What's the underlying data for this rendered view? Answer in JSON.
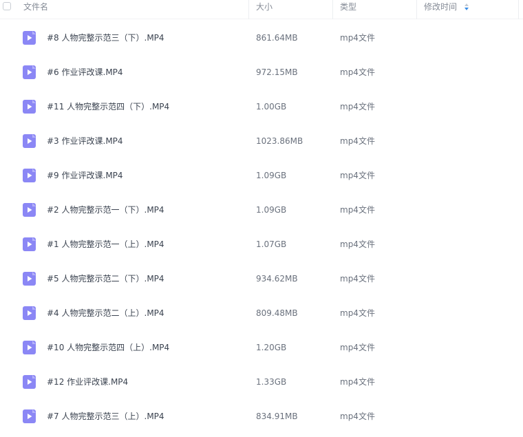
{
  "columns": {
    "name": "文件名",
    "size": "大小",
    "type": "类型",
    "modified": "修改时间"
  },
  "icons": {
    "file_icon": "video-file-icon",
    "sort_icon": "sort-icon",
    "accent_color": "#8b87f5"
  },
  "files": [
    {
      "name": "#8 人物完整示范三（下）.MP4",
      "size": "861.64MB",
      "type": "mp4文件",
      "modified": ""
    },
    {
      "name": "#6 作业评改课.MP4",
      "size": "972.15MB",
      "type": "mp4文件",
      "modified": ""
    },
    {
      "name": "#11 人物完整示范四（下）.MP4",
      "size": "1.00GB",
      "type": "mp4文件",
      "modified": ""
    },
    {
      "name": "#3 作业评改课.MP4",
      "size": "1023.86MB",
      "type": "mp4文件",
      "modified": ""
    },
    {
      "name": "#9 作业评改课.MP4",
      "size": "1.09GB",
      "type": "mp4文件",
      "modified": ""
    },
    {
      "name": "#2 人物完整示范一（下）.MP4",
      "size": "1.09GB",
      "type": "mp4文件",
      "modified": ""
    },
    {
      "name": "#1 人物完整示范一（上）.MP4",
      "size": "1.07GB",
      "type": "mp4文件",
      "modified": ""
    },
    {
      "name": "#5 人物完整示范二（下）.MP4",
      "size": "934.62MB",
      "type": "mp4文件",
      "modified": ""
    },
    {
      "name": "#4 人物完整示范二（上）.MP4",
      "size": "809.48MB",
      "type": "mp4文件",
      "modified": ""
    },
    {
      "name": "#10 人物完整示范四（上）.MP4",
      "size": "1.20GB",
      "type": "mp4文件",
      "modified": ""
    },
    {
      "name": "#12 作业评改课.MP4",
      "size": "1.33GB",
      "type": "mp4文件",
      "modified": ""
    },
    {
      "name": "#7 人物完整示范三（上）.MP4",
      "size": "834.91MB",
      "type": "mp4文件",
      "modified": ""
    }
  ]
}
